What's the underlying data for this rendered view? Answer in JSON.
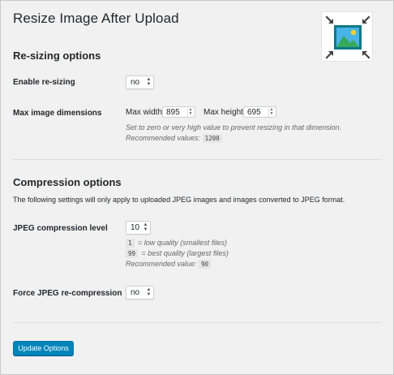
{
  "page": {
    "title": "Resize Image After Upload"
  },
  "plugin_icon": {
    "name": "resize-image-icon",
    "colors": {
      "frame": "#0d7a85",
      "sky": "#48b3e6",
      "mountains": "#37a85c",
      "sun": "#f4d23b",
      "arrows": "#444444"
    }
  },
  "resizing": {
    "section_title": "Re-sizing options",
    "enable": {
      "label": "Enable re-sizing",
      "value": "no"
    },
    "dimensions": {
      "label": "Max image dimensions",
      "width_label": "Max width",
      "width_value": "895",
      "height_label": "Max height",
      "height_value": "695",
      "hint_line1": "Set to zero or very high value to prevent resizing in that dimension.",
      "hint_line2_prefix": "Recommended values:",
      "hint_line2_code": "1200"
    }
  },
  "compression": {
    "section_title": "Compression options",
    "description": "The following settings will only apply to uploaded JPEG images and images converted to JPEG format.",
    "level": {
      "label": "JPEG compression level",
      "value": "10",
      "hint1_code": "1",
      "hint1_text": "= low quality (smallest files)",
      "hint2_code": "99",
      "hint2_text": "= best quality (largest files)",
      "hint3_prefix": "Recommended value:",
      "hint3_code": "90"
    },
    "force": {
      "label": "Force JPEG re-compression",
      "value": "no"
    }
  },
  "actions": {
    "update_label": "Update Options"
  },
  "colors": {
    "background": "#f1f1f1",
    "primary_button": "#0085ba",
    "text": "#23282d",
    "hint": "#666666"
  }
}
